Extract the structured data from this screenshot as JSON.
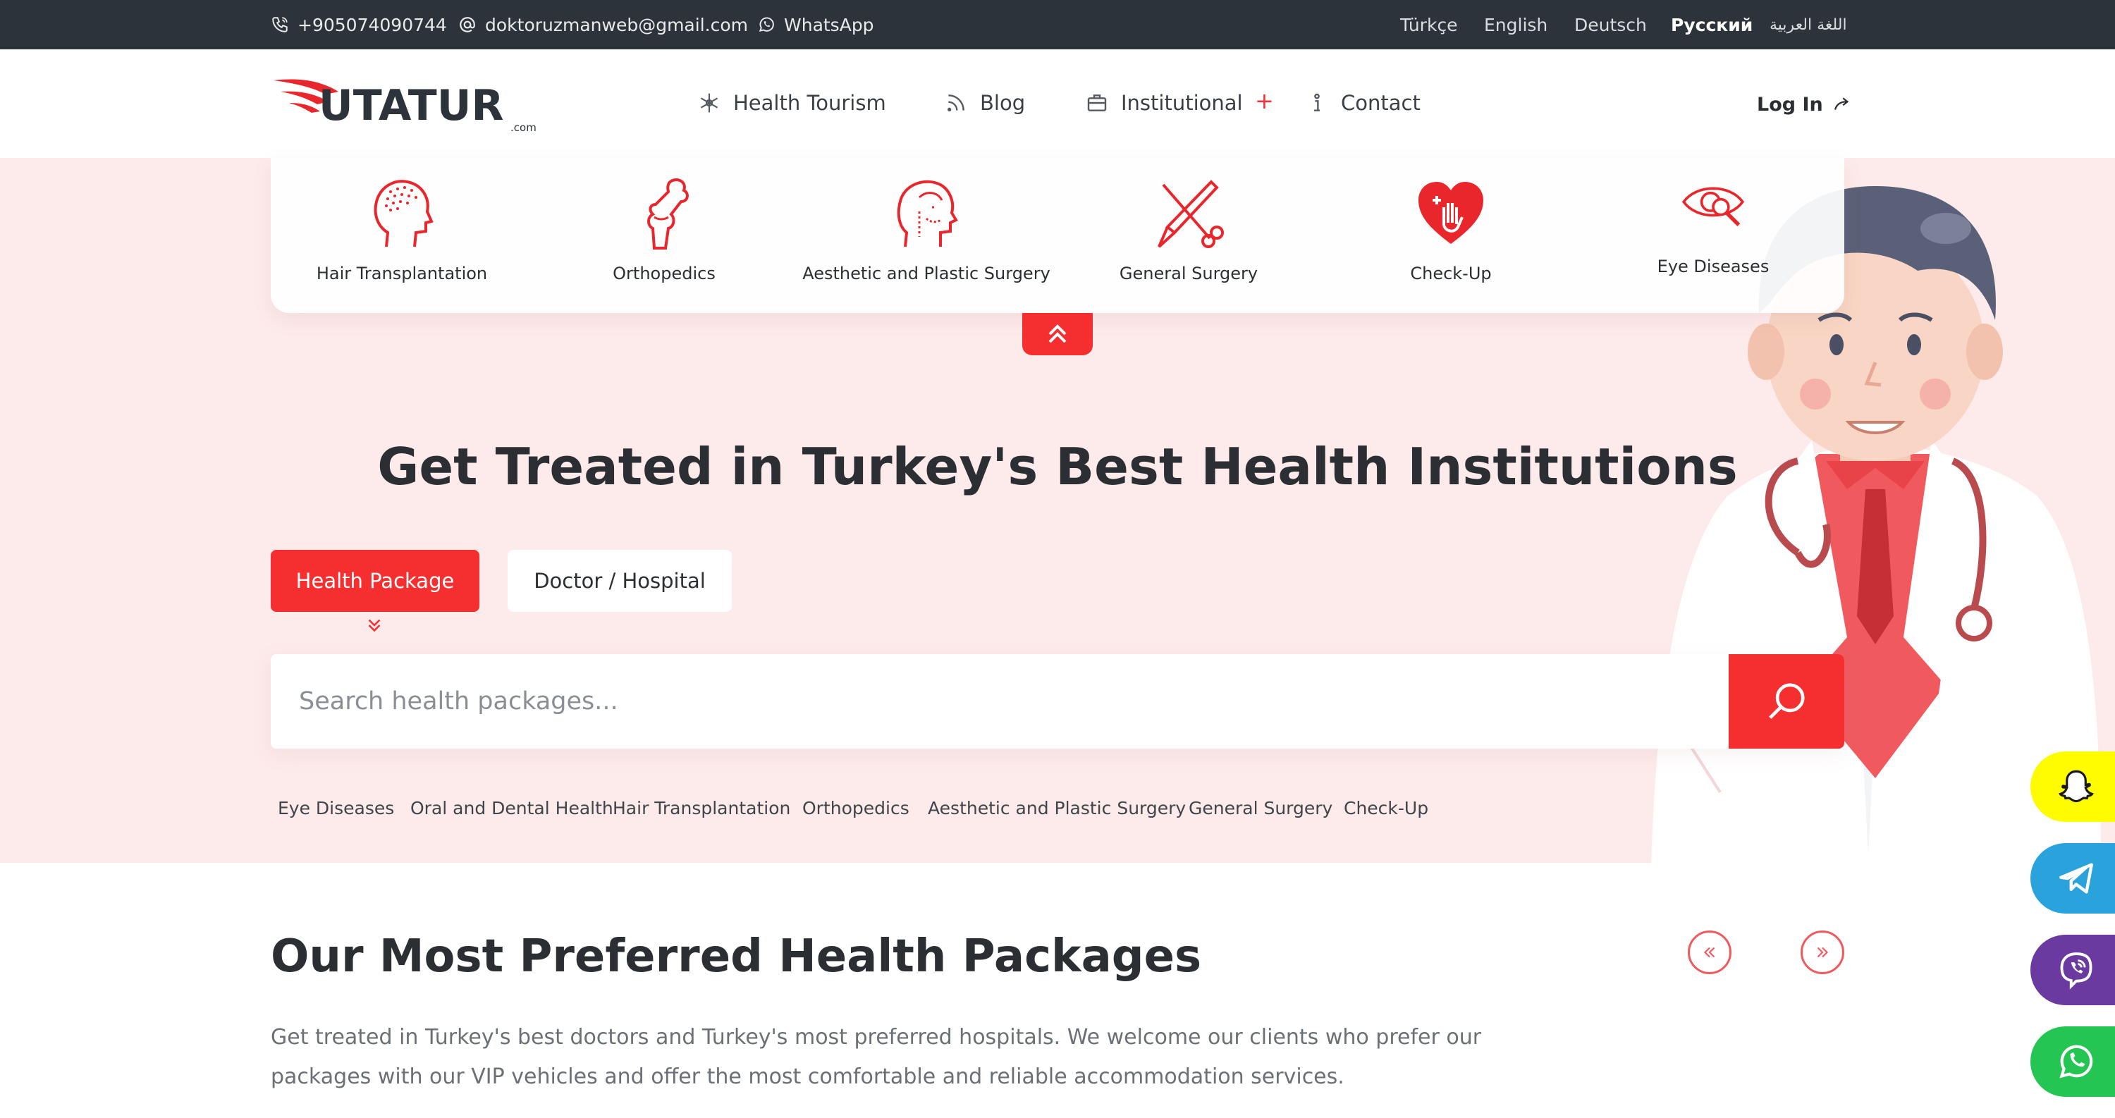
{
  "topbar": {
    "phone": "+905074090744",
    "email": "doktoruzmanweb@gmail.com",
    "whatsapp": "WhatsApp",
    "languages": [
      "Türkçe",
      "English",
      "Deutsch",
      "Русский",
      "اللغة العربية"
    ]
  },
  "nav": {
    "logo_text": "UTATUR",
    "logo_sub": ".com",
    "items": [
      "Health Tourism",
      "Blog",
      "Institutional",
      "Contact"
    ],
    "login": "Log In"
  },
  "categories": [
    {
      "label": "Hair Transplantation",
      "icon": "hair-transplant-icon"
    },
    {
      "label": "Orthopedics",
      "icon": "bone-icon"
    },
    {
      "label": "Aesthetic and Plastic Surgery",
      "icon": "face-icon"
    },
    {
      "label": "General Surgery",
      "icon": "scalpel-icon"
    },
    {
      "label": "Check-Up",
      "icon": "heart-hand-icon"
    },
    {
      "label": "Eye Diseases",
      "icon": "eye-icon"
    }
  ],
  "hero": {
    "title": "Get Treated in Turkey's Best Health Institutions",
    "tabs": [
      "Health Package",
      "Doctor / Hospital"
    ],
    "search_placeholder": "Search health packages...",
    "quick_links": [
      "Eye Diseases",
      "Oral and Dental Health",
      "Hair Transplantation",
      "Orthopedics",
      "Aesthetic and Plastic Surgery",
      "General Surgery",
      "Check-Up"
    ]
  },
  "packages": {
    "title": "Our Most Preferred Health Packages",
    "description": "Get treated in Turkey's best doctors and Turkey's most preferred hospitals. We welcome our clients who prefer our packages with our VIP vehicles and offer the most comfortable and reliable accommodation services."
  },
  "social": [
    "snapchat-icon",
    "telegram-icon",
    "viber-icon",
    "whatsapp-icon"
  ],
  "colors": {
    "accent": "#f52f2f",
    "topbar": "#2d333a",
    "hero_bg": "#fdeaea",
    "snapchat": "#fffc00",
    "telegram": "#2aa3dc",
    "viber": "#6a3aa0",
    "whatsapp": "#25c554"
  }
}
